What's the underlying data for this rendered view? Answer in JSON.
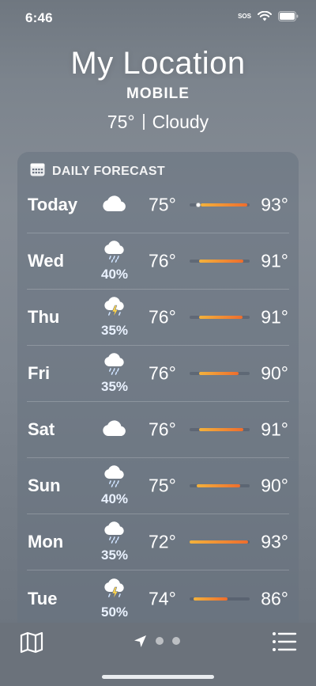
{
  "status": {
    "time": "6:46",
    "sos": "SOS"
  },
  "location": {
    "title": "My Location",
    "subtitle": "MOBILE",
    "temp": "75°",
    "condition": "Cloudy"
  },
  "forecast": {
    "header": "DAILY FORECAST",
    "icon": "calendar-icon",
    "days": [
      {
        "day": "Today",
        "icon": "cloud-icon",
        "precip": "",
        "low": "75°",
        "high": "93°",
        "range": [
          0.18,
          0.96
        ],
        "current": 0.15
      },
      {
        "day": "Wed",
        "icon": "cloud-rain-icon",
        "precip": "40%",
        "low": "76°",
        "high": "91°",
        "range": [
          0.16,
          0.9
        ],
        "current": null
      },
      {
        "day": "Thu",
        "icon": "cloud-thunderstorm-icon",
        "precip": "35%",
        "low": "76°",
        "high": "91°",
        "range": [
          0.16,
          0.88
        ],
        "current": null
      },
      {
        "day": "Fri",
        "icon": "cloud-rain-icon",
        "precip": "35%",
        "low": "76°",
        "high": "90°",
        "range": [
          0.16,
          0.82
        ],
        "current": null
      },
      {
        "day": "Sat",
        "icon": "cloud-icon",
        "precip": "",
        "low": "76°",
        "high": "91°",
        "range": [
          0.16,
          0.9
        ],
        "current": null
      },
      {
        "day": "Sun",
        "icon": "cloud-rain-icon",
        "precip": "40%",
        "low": "75°",
        "high": "90°",
        "range": [
          0.12,
          0.84
        ],
        "current": null
      },
      {
        "day": "Mon",
        "icon": "cloud-rain-icon",
        "precip": "35%",
        "low": "72°",
        "high": "93°",
        "range": [
          0.0,
          0.97
        ],
        "current": null
      },
      {
        "day": "Tue",
        "icon": "cloud-thunderstorm-icon",
        "precip": "50%",
        "low": "74°",
        "high": "86°",
        "range": [
          0.06,
          0.63
        ],
        "current": null
      }
    ]
  },
  "toolbar": {
    "map_icon": "map-icon",
    "location_icon": "location-arrow-icon",
    "list_icon": "list-icon"
  },
  "colors": {
    "bar_start": "#f3b23c",
    "bar_end": "#ee6d2d"
  }
}
